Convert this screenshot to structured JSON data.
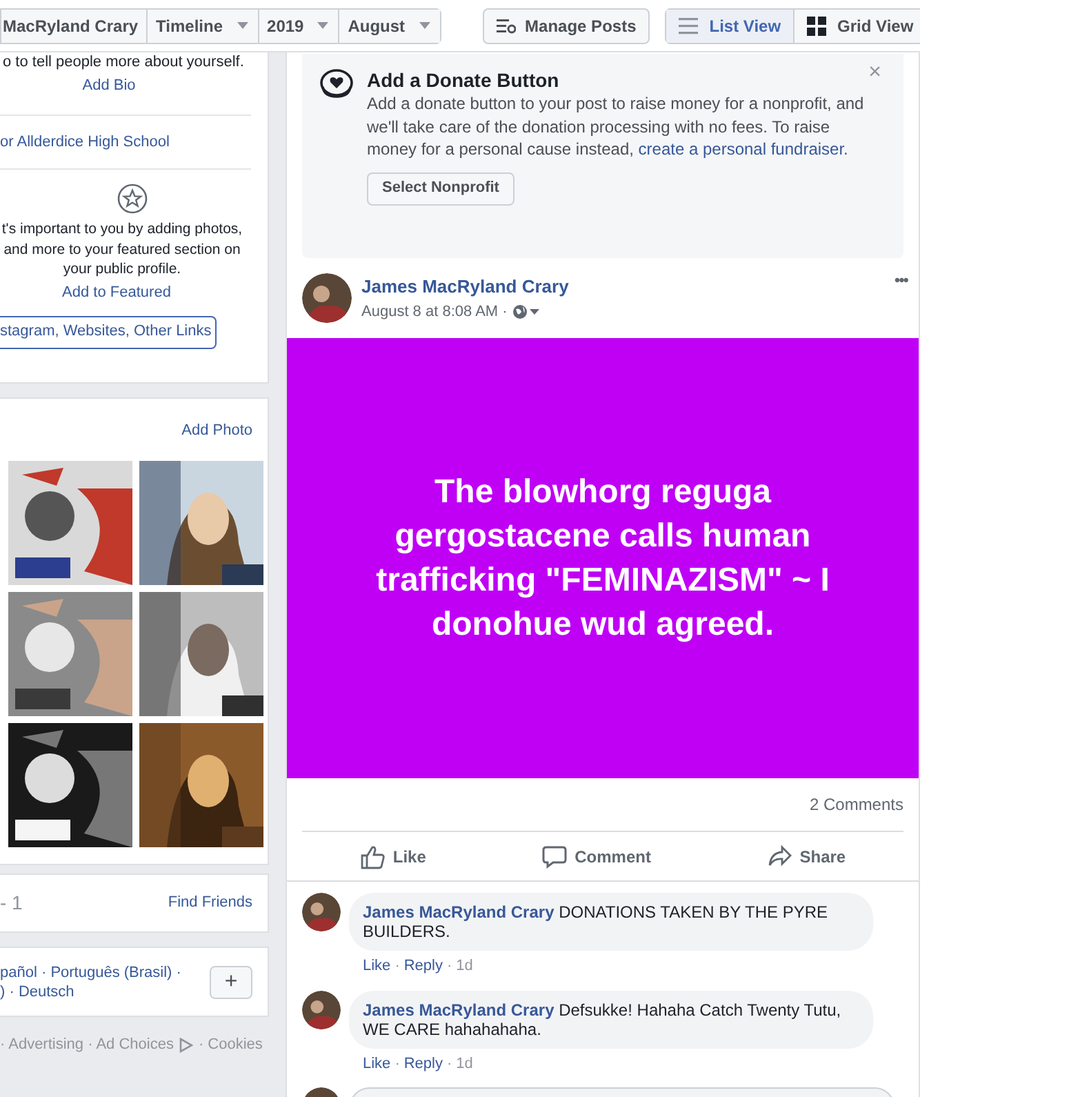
{
  "top_bar": {
    "breadcrumbs": [
      {
        "label": "MacRyland Crary",
        "dropdown": false
      },
      {
        "label": "Timeline",
        "dropdown": true
      },
      {
        "label": "2019",
        "dropdown": true
      },
      {
        "label": "August",
        "dropdown": true
      }
    ],
    "manage_posts": "Manage Posts",
    "views": [
      {
        "label": "List View",
        "selected": true
      },
      {
        "label": "Grid View",
        "selected": false
      }
    ]
  },
  "intro": {
    "bio_text": "o to tell people more about yourself.",
    "add_bio": "Add Bio",
    "school": "or Allderdice High School",
    "featured_text": "t's important to you by adding photos, and more to your featured section on your public profile.",
    "add_featured": "Add to Featured",
    "links_button": "stagram, Websites, Other Links"
  },
  "photos": {
    "add_photo": "Add Photo"
  },
  "friends": {
    "count": "- 1",
    "find_friends": "Find Friends"
  },
  "languages": {
    "lines": [
      "pañol · Português (Brasil) ·",
      ") · Deutsch"
    ],
    "add": "+"
  },
  "footer": {
    "links": [
      "· Advertising · Ad Choices",
      "· Cookies"
    ]
  },
  "donate": {
    "title": "Add a Donate Button",
    "text": "Add a donate button to your post to raise money for a nonprofit, and we'll take care of the donation processing with no fees. To raise money for a personal cause instead,",
    "link": "create a personal fundraiser.",
    "button": "Select Nonprofit",
    "close": "×"
  },
  "post": {
    "author": "James MacRyland Crary",
    "time": "August 8 at 8:08 AM ·",
    "more": "•••",
    "text": "The blowhorg reguga gergostacene calls human trafficking \"FEMINAZISM\" ~ I donohue wud agreed.",
    "comment_count": "2 Comments",
    "actions": [
      {
        "kind": "like",
        "label": "Like"
      },
      {
        "kind": "comment",
        "label": "Comment"
      },
      {
        "kind": "share",
        "label": "Share"
      }
    ]
  },
  "comments": [
    {
      "author": "James MacRyland Crary",
      "text": "DONATIONS TAKEN BY THE PYRE BUILDERS.",
      "like": "Like",
      "sep_1": "·",
      "reply": "Reply",
      "sep_2": "·",
      "age": "1d"
    },
    {
      "author": "James MacRyland Crary",
      "text": "Defsukke! Hahaha Catch Twenty Tutu, WE CARE hahahahaha.",
      "like": "Like",
      "sep_1": "·",
      "reply": "Reply",
      "sep_2": "·",
      "age": "1d"
    }
  ]
}
